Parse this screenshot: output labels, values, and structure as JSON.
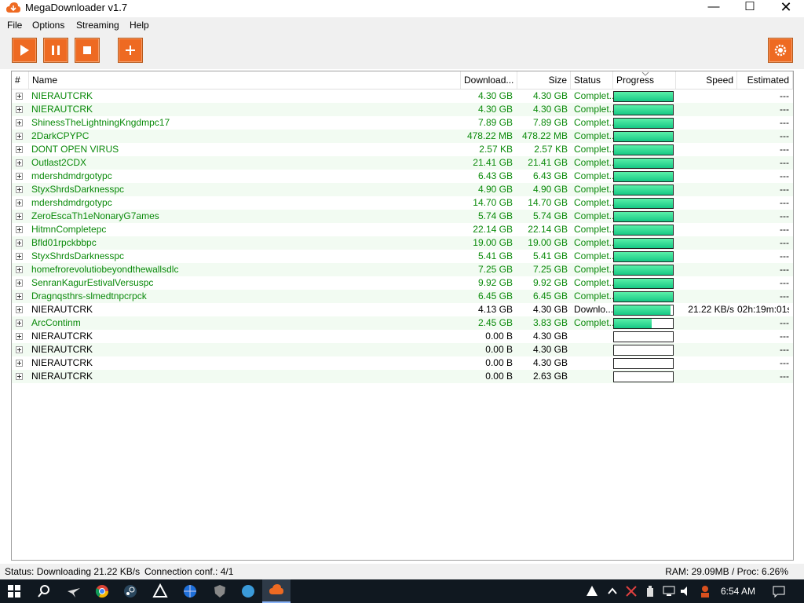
{
  "window": {
    "title": "MegaDownloader v1.7"
  },
  "menu": [
    "File",
    "Options",
    "Streaming",
    "Help"
  ],
  "columns": {
    "num": "#",
    "name": "Name",
    "downloaded": "Download...",
    "size": "Size",
    "status": "Status",
    "progress": "Progress",
    "speed": "Speed",
    "estimated": "Estimated"
  },
  "rows": [
    {
      "name": "NIERAUTCRK",
      "downloaded": "4.30 GB",
      "size": "4.30 GB",
      "status": "Complet...",
      "progress": 1.0,
      "speed": "",
      "estimated": "---",
      "green": true
    },
    {
      "name": "NIERAUTCRK",
      "downloaded": "4.30 GB",
      "size": "4.30 GB",
      "status": "Complet...",
      "progress": 1.0,
      "speed": "",
      "estimated": "---",
      "green": true
    },
    {
      "name": "ShinessTheLightningKngdmpc17",
      "downloaded": "7.89 GB",
      "size": "7.89 GB",
      "status": "Complet...",
      "progress": 1.0,
      "speed": "",
      "estimated": "---",
      "green": true
    },
    {
      "name": "2DarkCPYPC",
      "downloaded": "478.22 MB",
      "size": "478.22 MB",
      "status": "Complet...",
      "progress": 1.0,
      "speed": "",
      "estimated": "---",
      "green": true
    },
    {
      "name": "DONT OPEN VIRUS",
      "downloaded": "2.57 KB",
      "size": "2.57 KB",
      "status": "Complet...",
      "progress": 1.0,
      "speed": "",
      "estimated": "---",
      "green": true
    },
    {
      "name": "Outlast2CDX",
      "downloaded": "21.41 GB",
      "size": "21.41 GB",
      "status": "Complet...",
      "progress": 1.0,
      "speed": "",
      "estimated": "---",
      "green": true
    },
    {
      "name": "mdershdmdrgotypc",
      "downloaded": "6.43 GB",
      "size": "6.43 GB",
      "status": "Complet...",
      "progress": 1.0,
      "speed": "",
      "estimated": "---",
      "green": true
    },
    {
      "name": "StyxShrdsDarknesspc",
      "downloaded": "4.90 GB",
      "size": "4.90 GB",
      "status": "Complet...",
      "progress": 1.0,
      "speed": "",
      "estimated": "---",
      "green": true
    },
    {
      "name": "mdershdmdrgotypc",
      "downloaded": "14.70 GB",
      "size": "14.70 GB",
      "status": "Complet...",
      "progress": 1.0,
      "speed": "",
      "estimated": "---",
      "green": true
    },
    {
      "name": "ZeroEscaTh1eNonaryG7ames",
      "downloaded": "5.74 GB",
      "size": "5.74 GB",
      "status": "Complet...",
      "progress": 1.0,
      "speed": "",
      "estimated": "---",
      "green": true
    },
    {
      "name": "HitmnCompletepc",
      "downloaded": "22.14 GB",
      "size": "22.14 GB",
      "status": "Complet...",
      "progress": 1.0,
      "speed": "",
      "estimated": "---",
      "green": true
    },
    {
      "name": "Bfld01rpckbbpc",
      "downloaded": "19.00 GB",
      "size": "19.00 GB",
      "status": "Complet...",
      "progress": 1.0,
      "speed": "",
      "estimated": "---",
      "green": true
    },
    {
      "name": "StyxShrdsDarknesspc",
      "downloaded": "5.41 GB",
      "size": "5.41 GB",
      "status": "Complet...",
      "progress": 1.0,
      "speed": "",
      "estimated": "---",
      "green": true
    },
    {
      "name": "homefrorevolutiobeyondthewallsdlc",
      "downloaded": "7.25 GB",
      "size": "7.25 GB",
      "status": "Complet...",
      "progress": 1.0,
      "speed": "",
      "estimated": "---",
      "green": true
    },
    {
      "name": "SenranKagurEstivalVersuspc",
      "downloaded": "9.92 GB",
      "size": "9.92 GB",
      "status": "Complet...",
      "progress": 1.0,
      "speed": "",
      "estimated": "---",
      "green": true
    },
    {
      "name": "Dragnqsthrs-slmedtnpcrpck",
      "downloaded": "6.45 GB",
      "size": "6.45 GB",
      "status": "Complet...",
      "progress": 1.0,
      "speed": "",
      "estimated": "---",
      "green": true
    },
    {
      "name": "NIERAUTCRK",
      "downloaded": "4.13 GB",
      "size": "4.30 GB",
      "status": "Downlo...",
      "progress": 0.96,
      "speed": "21.22 KB/s",
      "estimated": "02h:19m:01s",
      "green": false
    },
    {
      "name": "ArcContinm",
      "downloaded": "2.45 GB",
      "size": "3.83 GB",
      "status": "Complet...",
      "progress": 0.64,
      "speed": "",
      "estimated": "---",
      "green": true
    },
    {
      "name": "NIERAUTCRK",
      "downloaded": "0.00 B",
      "size": "4.30 GB",
      "status": "",
      "progress": 0.0,
      "speed": "",
      "estimated": "---",
      "green": false
    },
    {
      "name": "NIERAUTCRK",
      "downloaded": "0.00 B",
      "size": "4.30 GB",
      "status": "",
      "progress": 0.0,
      "speed": "",
      "estimated": "---",
      "green": false
    },
    {
      "name": "NIERAUTCRK",
      "downloaded": "0.00 B",
      "size": "4.30 GB",
      "status": "",
      "progress": 0.0,
      "speed": "",
      "estimated": "---",
      "green": false
    },
    {
      "name": "NIERAUTCRK",
      "downloaded": "0.00 B",
      "size": "2.63 GB",
      "status": "",
      "progress": 0.0,
      "speed": "",
      "estimated": "---",
      "green": false
    }
  ],
  "status": {
    "left": "Status: Downloading 21.22 KB/s",
    "conn": "Connection conf.: 4/1",
    "right": "RAM: 29.09MB / Proc: 6.26%"
  },
  "taskbar": {
    "time": "6:54 AM"
  },
  "colors": {
    "accent": "#ee6a22",
    "complete_text": "#0a8a0a",
    "progress_fill": "#2bd88f",
    "alt_row": "#f2fbf2"
  }
}
